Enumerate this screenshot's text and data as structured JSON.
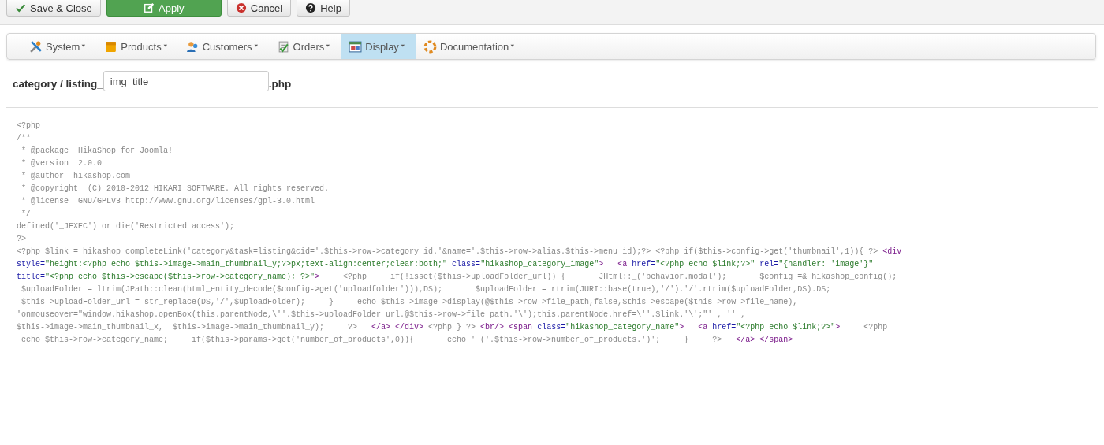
{
  "toolbar": [
    {
      "label": "Save & Close",
      "kind": "save"
    },
    {
      "label": "Apply",
      "kind": "apply"
    },
    {
      "label": "Cancel",
      "kind": "cancel"
    },
    {
      "label": "Help",
      "kind": "help"
    }
  ],
  "menu": [
    {
      "label": "System",
      "kind": "system",
      "selected": false
    },
    {
      "label": "Products",
      "kind": "products",
      "selected": false
    },
    {
      "label": "Customers",
      "kind": "customers",
      "selected": false
    },
    {
      "label": "Orders",
      "kind": "orders",
      "selected": false
    },
    {
      "label": "Display",
      "kind": "display",
      "selected": true
    },
    {
      "label": "Documentation",
      "kind": "documentation",
      "selected": false
    }
  ],
  "file": {
    "prefix": "category / listing_",
    "value": "img_title",
    "suffix": ".php"
  },
  "code_lines": [
    {
      "segments": [
        {
          "kind": "php",
          "text": "<?php"
        }
      ]
    },
    {
      "segments": [
        {
          "kind": "php",
          "text": "/**"
        }
      ]
    },
    {
      "segments": [
        {
          "kind": "php",
          "text": " * @package  HikaShop for Joomla!"
        }
      ]
    },
    {
      "segments": [
        {
          "kind": "php",
          "text": " * @version  2.0.0"
        }
      ]
    },
    {
      "segments": [
        {
          "kind": "php",
          "text": " * @author  hikashop.com"
        }
      ]
    },
    {
      "segments": [
        {
          "kind": "php",
          "text": " * @copyright  (C) 2010-2012 HIKARI SOFTWARE. All rights reserved."
        }
      ]
    },
    {
      "segments": [
        {
          "kind": "php",
          "text": " * @license  GNU/GPLv3 http://www.gnu.org/licenses/gpl-3.0.html"
        }
      ]
    },
    {
      "segments": [
        {
          "kind": "php",
          "text": " */"
        }
      ]
    },
    {
      "segments": [
        {
          "kind": "php",
          "text": "defined('_JEXEC') or die('Restricted access');"
        }
      ]
    },
    {
      "segments": [
        {
          "kind": "php",
          "text": "?>"
        }
      ]
    },
    {
      "segments": [
        {
          "kind": "php",
          "text": "<?php $link = hikashop_completeLink('category&task=listing&cid='.$this->row->category_id.'&name='.$this->row->alias.$this->menu_id);?> <?php if($this->config->get('thumbnail',1)){ ?> "
        },
        {
          "kind": "tag",
          "text": "<div"
        }
      ]
    },
    {
      "segments": [
        {
          "kind": "attr",
          "text": "style="
        },
        {
          "kind": "string",
          "text": "\"height:<?php echo $this->image->main_thumbnail_y;?>px;text-align:center;clear:both;\""
        },
        {
          "kind": "attr",
          "text": " class="
        },
        {
          "kind": "string",
          "text": "\"hikashop_category_image\""
        },
        {
          "kind": "tag",
          "text": ">   <a"
        },
        {
          "kind": "attr",
          "text": " href="
        },
        {
          "kind": "string",
          "text": "\"<?php echo $link;?>\""
        },
        {
          "kind": "attr",
          "text": " rel="
        },
        {
          "kind": "string",
          "text": "\"{handler: 'image'}\""
        }
      ]
    },
    {
      "segments": [
        {
          "kind": "attr",
          "text": "title="
        },
        {
          "kind": "string",
          "text": "\"<?php echo $this->escape($this->row->category_name); ?>\""
        },
        {
          "kind": "tag",
          "text": ">"
        },
        {
          "kind": "php",
          "text": "     <?php     if(!isset($this->uploadFolder_url)) {       JHtml::_('behavior.modal');       $config =& hikashop_config();"
        }
      ]
    },
    {
      "segments": [
        {
          "kind": "php",
          "text": " $uploadFolder = ltrim(JPath::clean(html_entity_decode($config->get('uploadfolder'))),DS);       $uploadFolder = rtrim(JURI::base(true),'/').'/'.rtrim($uploadFolder,DS).DS;"
        }
      ]
    },
    {
      "segments": [
        {
          "kind": "php",
          "text": " $this->uploadFolder_url = str_replace(DS,'/',$uploadFolder);     }     echo $this->image->display(@$this->row->file_path,false,$this->escape($this->row->file_name),"
        }
      ]
    },
    {
      "segments": [
        {
          "kind": "php",
          "text": "'onmouseover=\"window.hikashop.openBox(this.parentNode,\\''.$this->uploadFolder_url.@$this->row->file_path.'\\');this.parentNode.href=\\''.$link.'\\';\"' , '' ,"
        }
      ]
    },
    {
      "segments": [
        {
          "kind": "php",
          "text": "$this->image->main_thumbnail_x,  $this->image->main_thumbnail_y);     ?>   "
        },
        {
          "kind": "tag",
          "text": "</a> </div>"
        },
        {
          "kind": "php",
          "text": " <?php } ?> "
        },
        {
          "kind": "tag",
          "text": "<br/> <span"
        },
        {
          "kind": "attr",
          "text": " class="
        },
        {
          "kind": "string",
          "text": "\"hikashop_category_name\""
        },
        {
          "kind": "tag",
          "text": ">   <a"
        },
        {
          "kind": "attr",
          "text": " href="
        },
        {
          "kind": "string",
          "text": "\"<?php echo $link;?>\""
        },
        {
          "kind": "tag",
          "text": ">"
        },
        {
          "kind": "php",
          "text": "     <?php"
        }
      ]
    },
    {
      "segments": [
        {
          "kind": "php",
          "text": " echo $this->row->category_name;     if($this->params->get('number_of_products',0)){       echo ' ('.$this->row->number_of_products.')';     }     ?>   "
        },
        {
          "kind": "tag",
          "text": "</a> </span>"
        }
      ]
    }
  ]
}
